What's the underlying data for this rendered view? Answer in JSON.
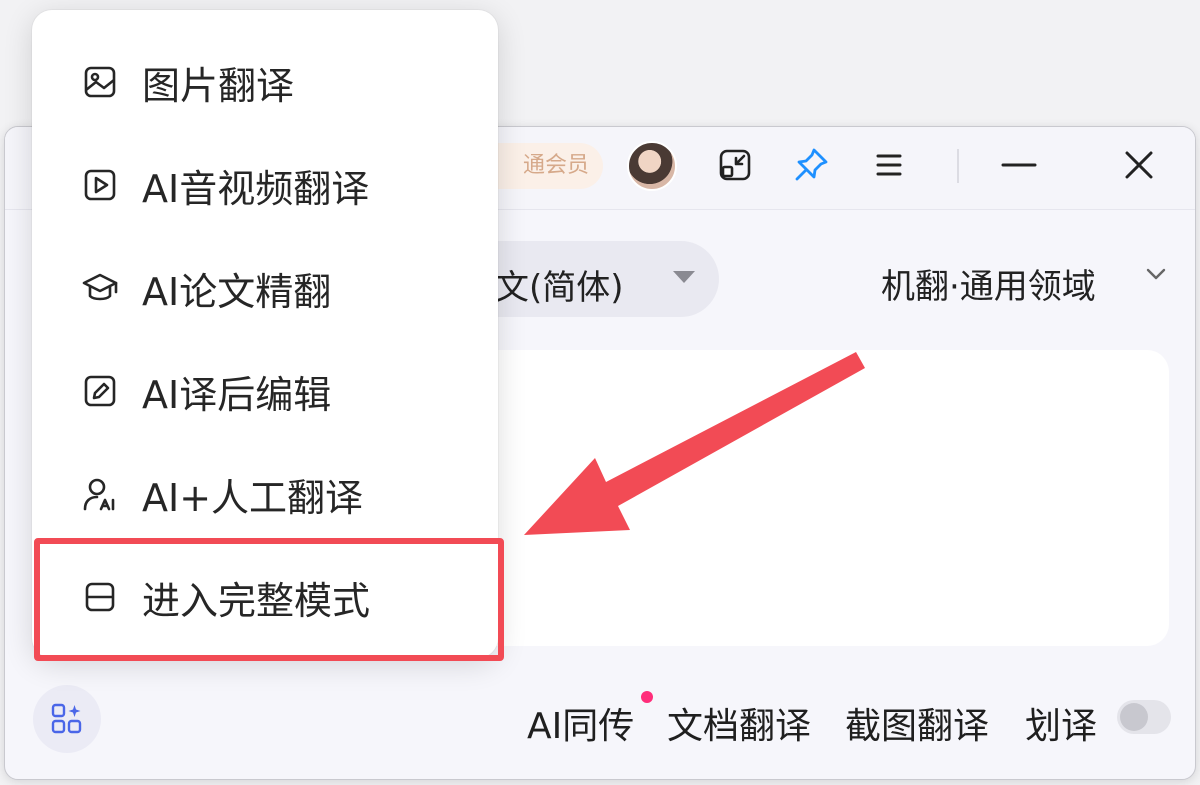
{
  "titlebar": {
    "vip_label": "通会员"
  },
  "language": {
    "target": "文(简体)",
    "engine": "机翻·通用领域"
  },
  "menu": {
    "items": [
      {
        "label": "图片翻译",
        "icon": "image-icon"
      },
      {
        "label": "AI音视频翻译",
        "icon": "video-play-icon"
      },
      {
        "label": "AI论文精翻",
        "icon": "graduation-cap-icon"
      },
      {
        "label": "AI译后编辑",
        "icon": "edit-pencil-icon"
      },
      {
        "label": "AI+人工翻译",
        "icon": "person-ai-icon"
      },
      {
        "label": "进入完整模式",
        "icon": "layout-icon"
      }
    ]
  },
  "bottom": {
    "ai_simul": "AI同传",
    "doc_translate": "文档翻译",
    "screenshot_translate": "截图翻译",
    "select_translate": "划译",
    "select_translate_enabled": false
  },
  "colors": {
    "highlight": "#f24b55",
    "pin_icon": "#1e90ff",
    "notification_dot": "#ff2d7a"
  }
}
